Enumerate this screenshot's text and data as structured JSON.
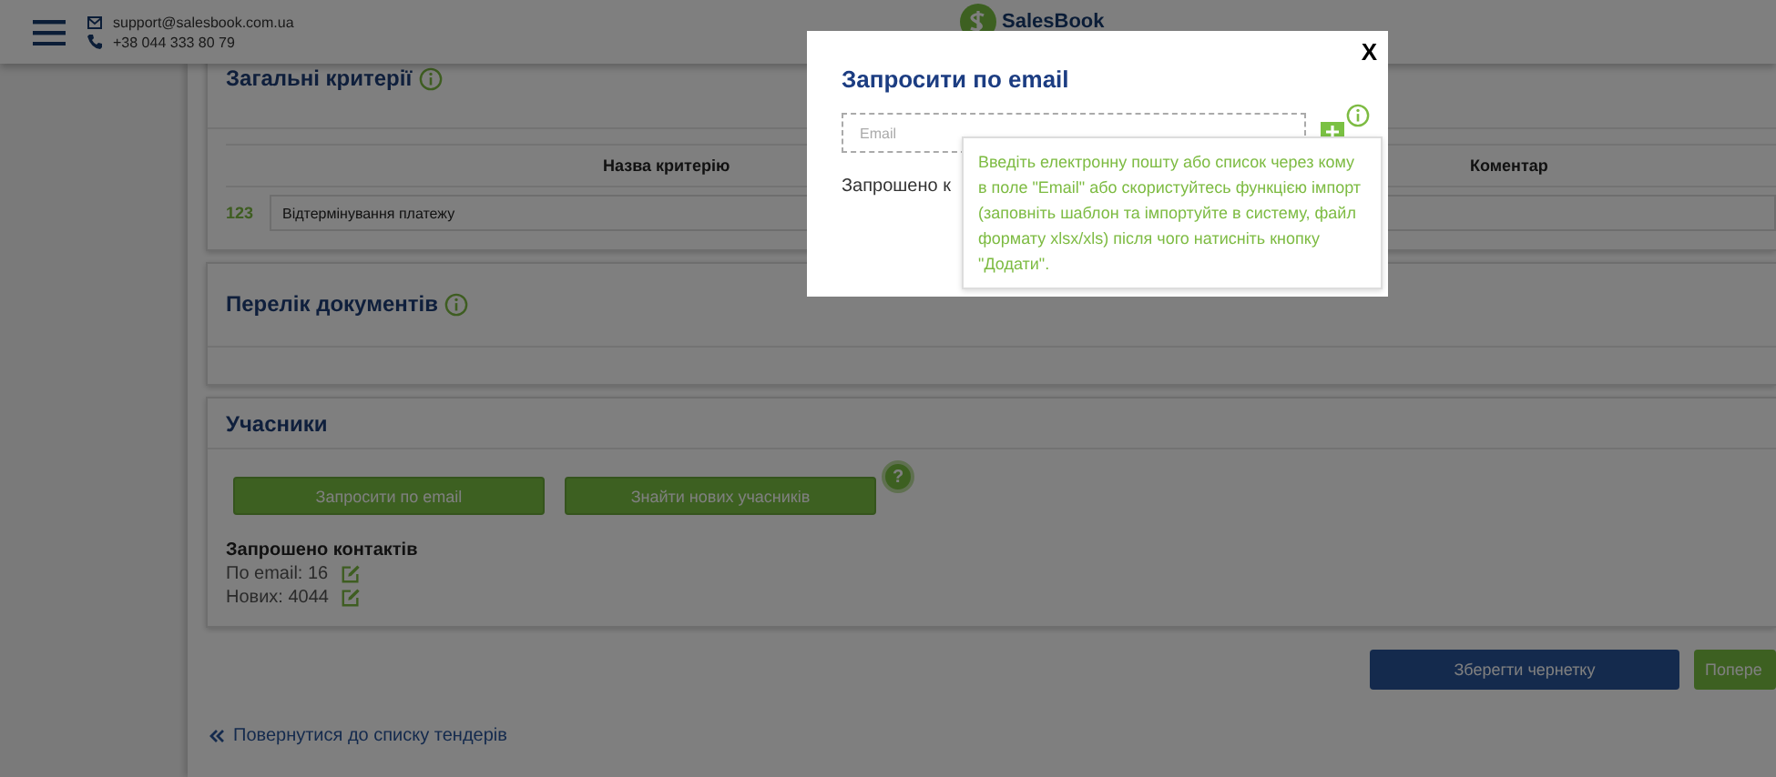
{
  "header": {
    "email": "support@salesbook.com.ua",
    "phone": "+38 044 333 80 79",
    "logo_text": "SalesBook"
  },
  "criteria": {
    "title": "Загальні критерії",
    "columns": [
      "Назва критерію",
      "Коментар"
    ],
    "rows": [
      {
        "type_label": "123",
        "name": "Відтермінування платежу"
      }
    ]
  },
  "documents": {
    "title": "Перелік документів"
  },
  "participants": {
    "title": "Учасники",
    "buttons": [
      "Запросити по email",
      "Знайти нових учасників"
    ],
    "help": "?",
    "invited_title": "Запрошено контактів",
    "invited": [
      "По email: 16",
      "Нових: 4044"
    ]
  },
  "actions": [
    "Зберегти чернетку",
    "Попере"
  ],
  "back_link": "Повернутися до списку тендерів",
  "modal": {
    "title": "Запросити по email",
    "close": "X",
    "email": {
      "placeholder": "Email"
    },
    "invited_label": "Запрошено к",
    "tooltip": "Введіть електронну пошту або список через кому в поле \"Email\" або скористуйтесь функцією імпорт (заповніть шаблон та імпортуйте в систему, файл формату xlsx/xls) після чого натисніть кнопку \"Додати\"."
  }
}
